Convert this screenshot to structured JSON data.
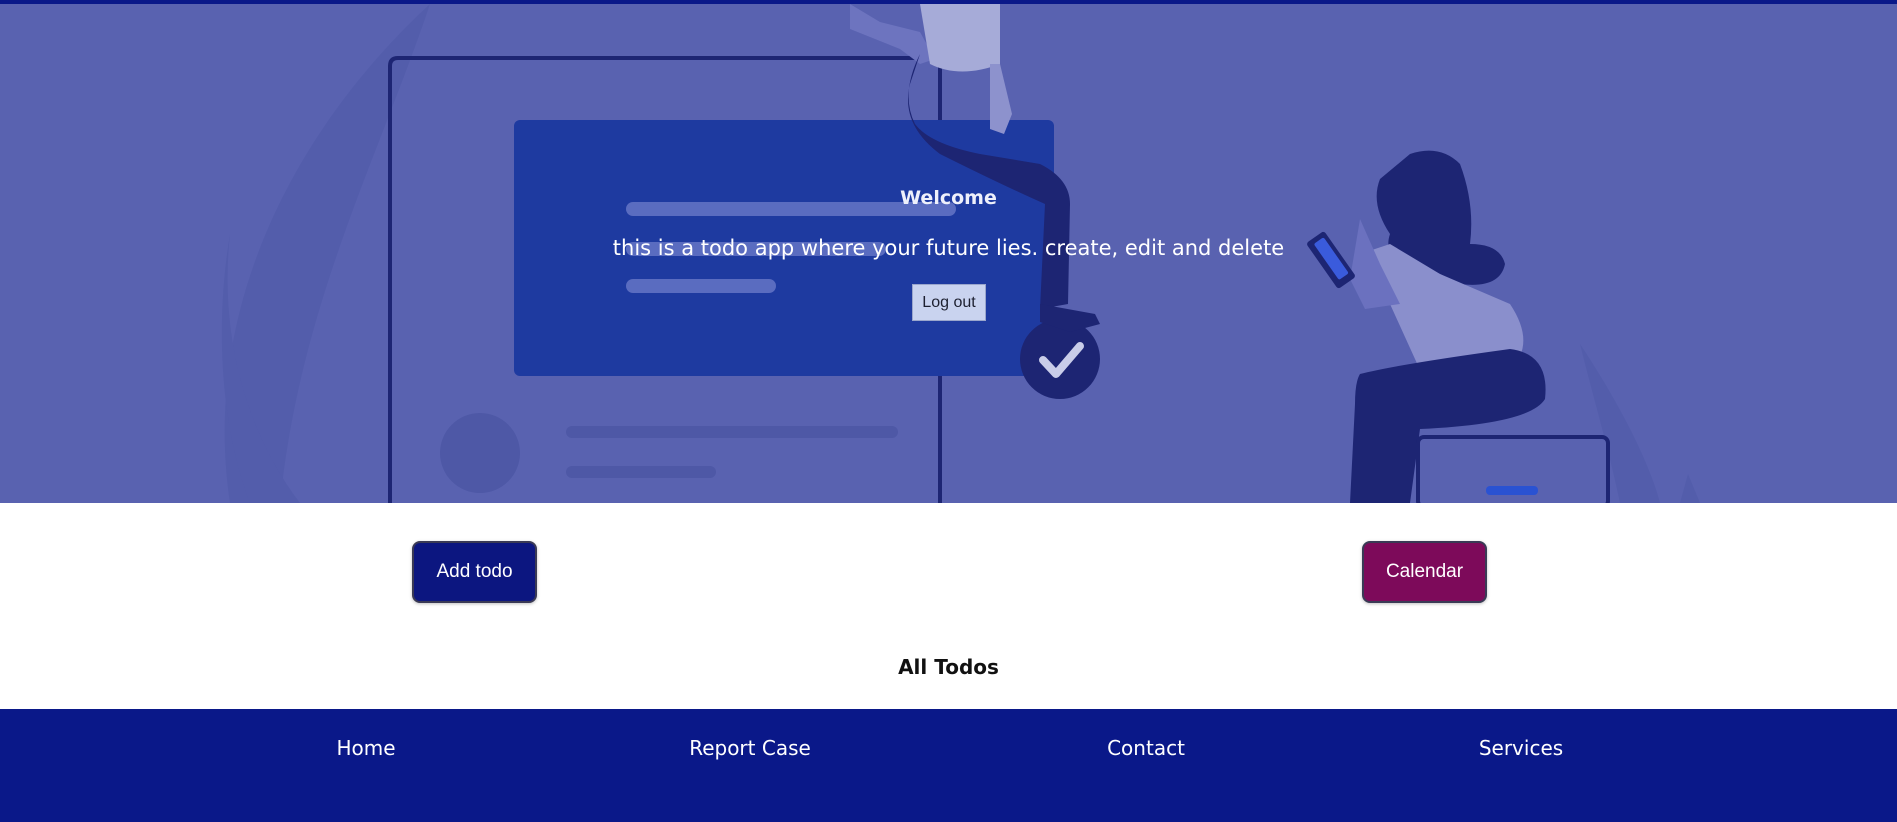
{
  "hero": {
    "title": "Welcome",
    "subtitle": "this is a todo app where your future lies. create, edit and delete",
    "logout_label": "Log out"
  },
  "actions": {
    "add_todo_label": "Add todo",
    "calendar_label": "Calendar"
  },
  "todos": {
    "heading": "All Todos"
  },
  "footer": {
    "links": [
      {
        "label": "Home"
      },
      {
        "label": "Report Case"
      },
      {
        "label": "Contact"
      },
      {
        "label": "Services"
      }
    ]
  },
  "colors": {
    "hero_background": "#5962b0",
    "navy": "#0a1889",
    "add_todo_button": "#0c1680",
    "calendar_button": "#7d0a5a",
    "logout_button": "#c9d3ef"
  }
}
